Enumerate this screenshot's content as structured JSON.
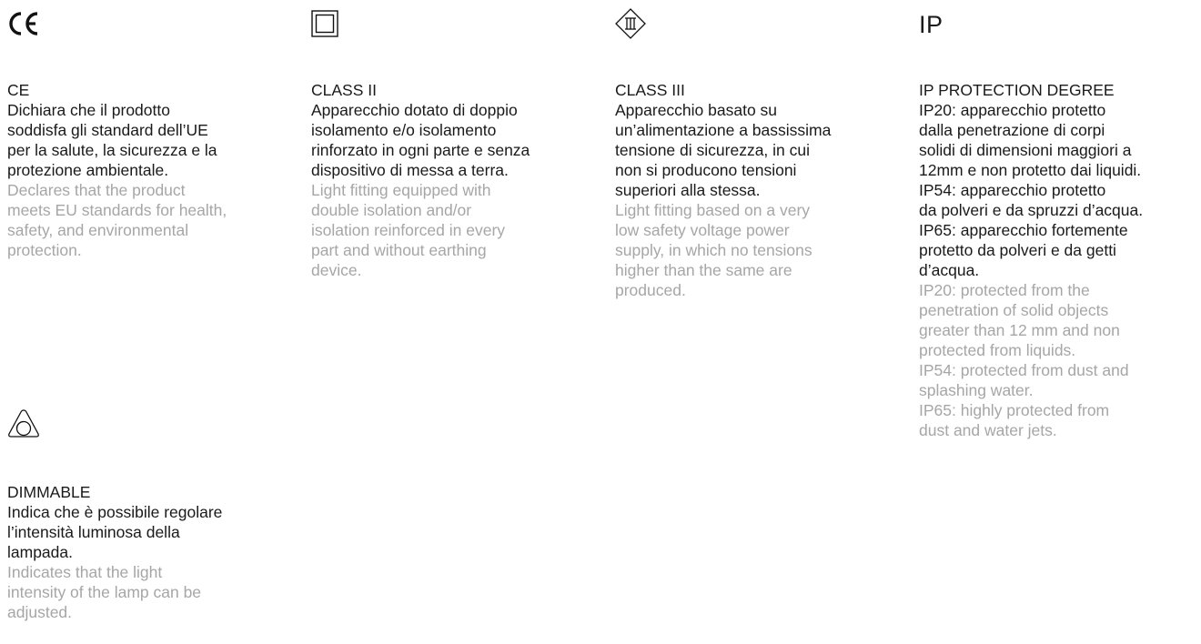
{
  "blocks": {
    "ce": {
      "icon": "ce-mark-icon",
      "title": "CE",
      "it": [
        "Dichiara che il prodotto",
        "soddisfa gli standard dell’UE",
        "per la salute, la sicurezza e la",
        "protezione ambientale."
      ],
      "en": [
        "Declares that the product",
        "meets EU standards for health,",
        "safety, and environmental",
        "protection."
      ]
    },
    "class2": {
      "icon": "class-ii-double-square-icon",
      "title": "CLASS II",
      "it": [
        "Apparecchio dotato di doppio",
        "isolamento e/o isolamento",
        "rinforzato in ogni parte e senza",
        "dispositivo di messa a terra."
      ],
      "en": [
        "Light fitting equipped with",
        "double isolation and/or",
        "isolation reinforced in every",
        "part and without earthing",
        "device."
      ]
    },
    "class3": {
      "icon": "class-iii-diamond-icon",
      "title": "CLASS III",
      "it": [
        "Apparecchio basato su",
        "un’alimentazione a bassissima",
        "tensione di sicurezza, in cui",
        "non si producono tensioni",
        "superiori alla stessa."
      ],
      "en": [
        "Light fitting based on a very",
        "low safety voltage power",
        "supply, in which no tensions",
        "higher than the same are",
        "produced."
      ]
    },
    "ip": {
      "icon_text": "IP",
      "title": "IP PROTECTION DEGREE",
      "it": [
        "IP20: apparecchio protetto",
        "dalla penetrazione di corpi",
        "solidi di dimensioni maggiori a",
        "12mm e non protetto dai liquidi.",
        "IP54: apparecchio protetto",
        "da polveri e da spruzzi d’acqua.",
        "IP65: apparecchio fortemente",
        "protetto da polveri e da getti",
        "d’acqua."
      ],
      "en": [
        "IP20: protected from the",
        "penetration of solid objects",
        "greater than 12 mm and non",
        "protected from liquids.",
        "IP54: protected from dust and",
        "splashing water.",
        "IP65: highly protected from",
        "dust and water jets."
      ]
    },
    "dim": {
      "icon": "dimmable-triangle-circle-icon",
      "title": "DIMMABLE",
      "it": [
        "Indica che è possibile regolare",
        "l’intensità luminosa della",
        "lampada."
      ],
      "en": [
        "Indicates that the light",
        "intensity of the lamp can be",
        "adjusted."
      ]
    }
  },
  "colors": {
    "primary_text": "#1a1a1a",
    "secondary_text": "#a6a6a6",
    "background": "#ffffff"
  }
}
